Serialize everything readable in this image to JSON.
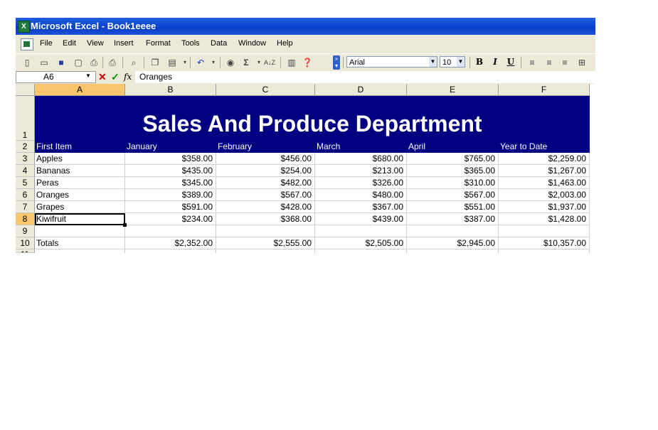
{
  "window": {
    "title": "Microsoft Excel - Book1eeee"
  },
  "menu": [
    "File",
    "Edit",
    "View",
    "Insert",
    "Format",
    "Tools",
    "Data",
    "Window",
    "Help"
  ],
  "toolbar": {
    "font_name": "Arial",
    "font_size": "10",
    "bold": "B",
    "italic": "I",
    "underline": "U",
    "autosum": "Σ",
    "sort": "A↓Z"
  },
  "formula_bar": {
    "name_box": "A6",
    "content": "Oranges"
  },
  "columns": [
    "A",
    "B",
    "C",
    "D",
    "E",
    "F"
  ],
  "rows": [
    "1",
    "2",
    "3",
    "4",
    "5",
    "6",
    "7",
    "8",
    "9",
    "10",
    "11"
  ],
  "sheet": {
    "banner": "Sales And Produce Department",
    "headers": [
      "First Item",
      "January",
      "February",
      "March",
      "April",
      "Year to Date"
    ],
    "data": [
      [
        "Apples",
        "$358.00",
        "$456.00",
        "$680.00",
        "$765.00",
        "$2,259.00"
      ],
      [
        "Bananas",
        "$435.00",
        "$254.00",
        "$213.00",
        "$365.00",
        "$1,267.00"
      ],
      [
        "Peras",
        "$345.00",
        "$482.00",
        "$326.00",
        "$310.00",
        "$1,463.00"
      ],
      [
        "Oranges",
        "$389.00",
        "$567.00",
        "$480.00",
        "$567.00",
        "$2,003.00"
      ],
      [
        "Grapes",
        "$591.00",
        "$428.00",
        "$367.00",
        "$551.00",
        "$1,937.00"
      ],
      [
        "Kiwifruit",
        "$234.00",
        "$368.00",
        "$439.00",
        "$387.00",
        "$1,428.00"
      ],
      [
        "",
        "",
        "",
        "",
        "",
        ""
      ],
      [
        "Totals",
        "$2,352.00",
        "$2,555.00",
        "$2,505.00",
        "$2,945.00",
        "$10,357.00"
      ]
    ]
  },
  "selection": {
    "cell": "A6",
    "row_index": 5,
    "col_index": 0
  },
  "colors": {
    "banner": "#000080",
    "active_header": "#f7c56b",
    "titlebar": "#0a3fc8"
  }
}
